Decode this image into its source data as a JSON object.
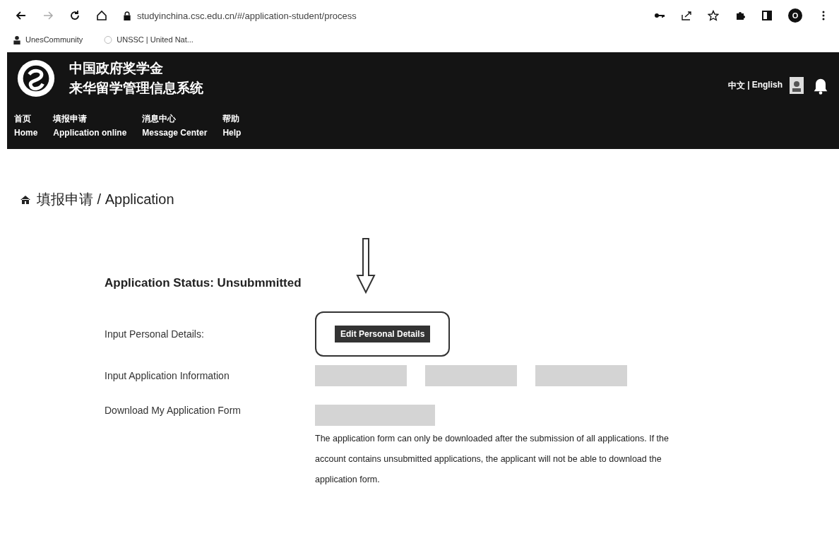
{
  "browser": {
    "url": "studyinchina.csc.edu.cn/#/application-student/process",
    "bookmarks": [
      "UnesCommunity",
      "UNSSC | United Nat..."
    ],
    "profile_initial": "O"
  },
  "header": {
    "title_lines": [
      "中国政府奖学金",
      "来华留学管理信息系统"
    ],
    "nav": [
      {
        "zh": "首页",
        "en": "Home"
      },
      {
        "zh": "填报申请",
        "en": "Application online"
      },
      {
        "zh": "消息中心",
        "en": "Message Center"
      },
      {
        "zh": "帮助",
        "en": "Help"
      }
    ],
    "languages": [
      "中文",
      "English"
    ],
    "language_separator": "|"
  },
  "breadcrumb": "填报申请 / Application",
  "status": "Application Status: Unsubmmitted",
  "rows": [
    {
      "label": "Input Personal Details:",
      "kind": "button",
      "button": "Edit Personal Details"
    },
    {
      "label": "Input Application Information",
      "kind": "blurred"
    },
    {
      "label": "Download My Application Form",
      "kind": "blurred-note",
      "note": "The application form can only be downloaded after the submission of all applications. If the account contains unsubmitted applications, the applicant will not be able to download the application form."
    }
  ]
}
